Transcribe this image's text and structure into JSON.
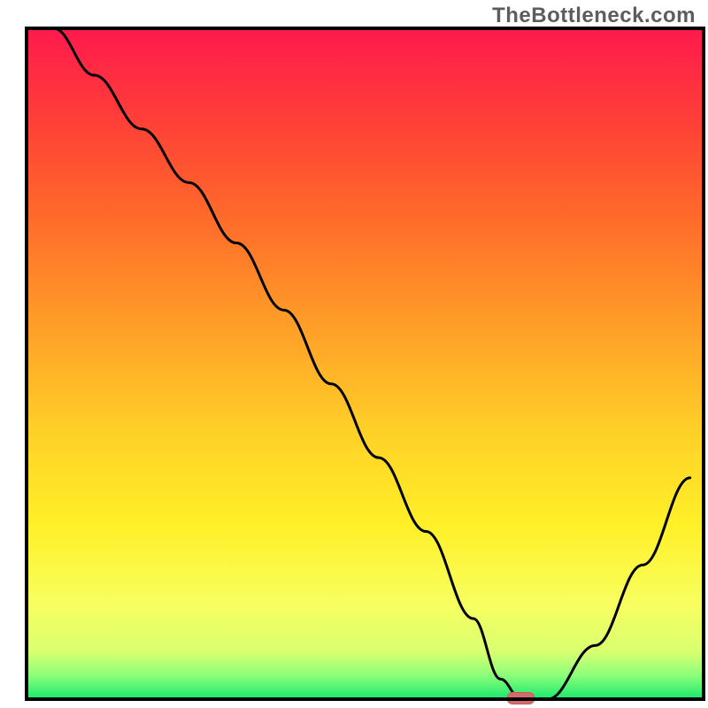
{
  "watermark": "TheBottleneck.com",
  "colors": {
    "border": "#000000",
    "curve": "#000000",
    "marker_fill": "#d46a6a",
    "marker_stroke": "#c95a5a"
  },
  "chart_data": {
    "type": "line",
    "title": "",
    "xlabel": "",
    "ylabel": "",
    "xlim": [
      0,
      100
    ],
    "ylim": [
      0,
      100
    ],
    "grid": false,
    "notes": "Axes have no tick labels; values below are approximate readings of the curve as percentages of plot width (x) and height (y=0 at bottom, 100 at top). Marker is a short horizontal capsule on the x-axis near x≈73.",
    "series": [
      {
        "name": "bottleneck-curve",
        "x": [
          4,
          10,
          17,
          24,
          31,
          38,
          45,
          52,
          59,
          66,
          70,
          73,
          77,
          84,
          91,
          98
        ],
        "y": [
          100,
          93,
          85,
          77,
          68,
          58,
          47,
          36,
          25,
          12,
          3,
          0,
          0,
          8,
          20,
          33
        ]
      }
    ],
    "marker": {
      "x_center_pct": 73,
      "width_pct": 4,
      "y_pct": 0
    },
    "gradient_stops": [
      {
        "offset": 0.0,
        "color": "#ff1a4d"
      },
      {
        "offset": 0.12,
        "color": "#ff3a3a"
      },
      {
        "offset": 0.28,
        "color": "#ff6a2a"
      },
      {
        "offset": 0.45,
        "color": "#ffa028"
      },
      {
        "offset": 0.6,
        "color": "#ffd028"
      },
      {
        "offset": 0.74,
        "color": "#fff028"
      },
      {
        "offset": 0.86,
        "color": "#f8ff60"
      },
      {
        "offset": 0.93,
        "color": "#d8ff70"
      },
      {
        "offset": 0.965,
        "color": "#8aff7a"
      },
      {
        "offset": 1.0,
        "color": "#19e86e"
      }
    ]
  }
}
